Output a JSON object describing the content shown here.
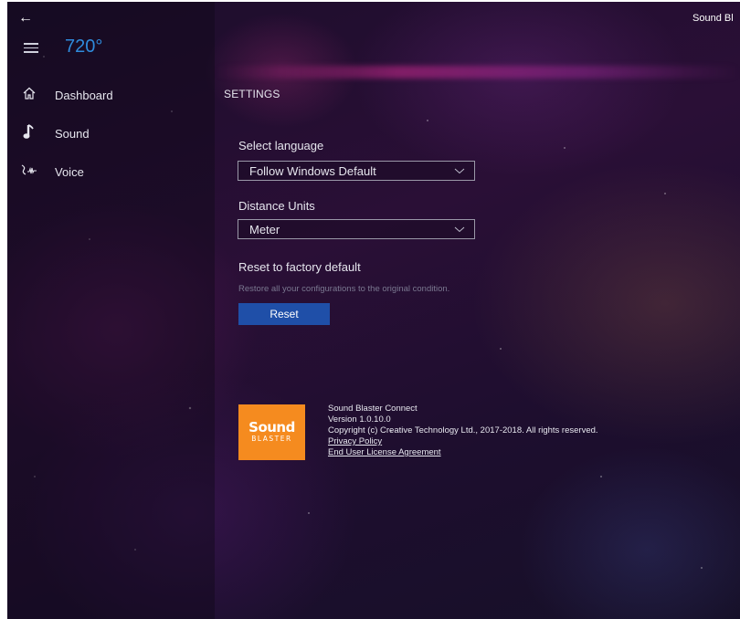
{
  "window": {
    "back_icon": "back-arrow-icon",
    "title_fragment": "Sound Bl"
  },
  "sidebar": {
    "menu_icon": "hamburger-menu-icon",
    "app_title": "720°",
    "items": [
      {
        "label": "Dashboard",
        "icon": "home-icon"
      },
      {
        "label": "Sound",
        "icon": "music-note-icon"
      },
      {
        "label": "Voice",
        "icon": "voice-icon"
      }
    ]
  },
  "settings": {
    "heading": "SETTINGS",
    "language": {
      "label": "Select language",
      "value": "Follow Windows Default"
    },
    "distance": {
      "label": "Distance Units",
      "value": "Meter"
    },
    "reset": {
      "label": "Reset to factory default",
      "description": "Restore all your configurations to the original condition.",
      "button": "Reset"
    }
  },
  "about": {
    "logo_line1": "Sound",
    "logo_line2": "BLASTER",
    "app_name": "Sound Blaster Connect",
    "version": "Version  1.0.10.0",
    "copyright": "Copyright (c) Creative Technology Ltd., 2017-2018. All rights reserved.",
    "privacy": "Privacy Policy",
    "eula": "End User License Agreement"
  },
  "colors": {
    "accent": "#2f8bdc",
    "button": "#1f4fa8",
    "logo": "#f58b1f"
  }
}
